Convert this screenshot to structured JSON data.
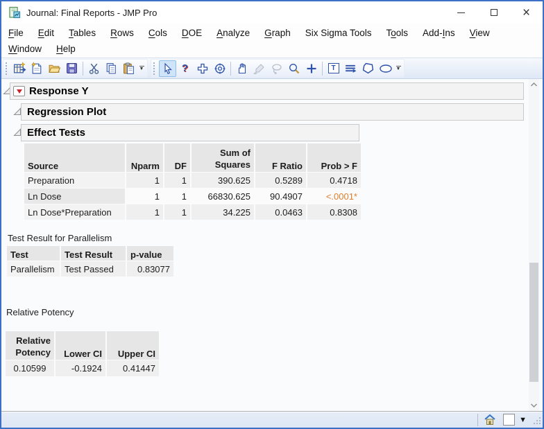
{
  "window": {
    "title": "Journal: Final Reports - JMP Pro"
  },
  "menu": {
    "row1": [
      {
        "label": "File",
        "m": 0
      },
      {
        "label": "Edit",
        "m": 0
      },
      {
        "label": "Tables",
        "m": 0
      },
      {
        "label": "Rows",
        "m": 0
      },
      {
        "label": "Cols",
        "m": 0
      },
      {
        "label": "DOE",
        "m": 0
      },
      {
        "label": "Analyze",
        "m": 0
      },
      {
        "label": "Graph",
        "m": 0
      },
      {
        "label": "Six Sigma Tools",
        "m": -1
      },
      {
        "label": "Tools",
        "m": 1
      },
      {
        "label": "Add-Ins",
        "m": 4
      },
      {
        "label": "View",
        "m": 0
      }
    ],
    "row2": [
      {
        "label": "Window",
        "m": 0
      },
      {
        "label": "Help",
        "m": 0
      }
    ]
  },
  "toolbar": {
    "groups": [
      {
        "icons": [
          "new-journal",
          "new-script",
          "open",
          "save",
          "cut",
          "copy",
          "paste"
        ]
      },
      {
        "icons": [
          "arrow-tool",
          "help-tool",
          "selection-tool",
          "bullseye-tool",
          "grabber-tool",
          "brush-tool",
          "lasso-tool",
          "magnifier-tool",
          "crosshairs-tool",
          "annotate-tool",
          "line-tool",
          "polygon-tool",
          "oval-tool"
        ]
      }
    ],
    "help_glyph": "?",
    "annotate_glyph": "T"
  },
  "outlines": [
    {
      "title": "Response Y"
    },
    {
      "title": "Regression Plot"
    },
    {
      "title": "Effect Tests"
    }
  ],
  "effect_tests": {
    "columns": {
      "source": "Source",
      "nparm": "Nparm",
      "df": "DF",
      "ss1": "Sum of",
      "ss2": "Squares",
      "f": "F Ratio",
      "p": "Prob > F"
    },
    "rows": [
      {
        "source": "Preparation",
        "nparm": "1",
        "df": "1",
        "ss": "390.625",
        "f": "0.5289",
        "p": "0.4718"
      },
      {
        "source": "Ln Dose",
        "nparm": "1",
        "df": "1",
        "ss": "66830.625",
        "f": "90.4907",
        "p": "<.0001*"
      },
      {
        "source": "Ln Dose*Preparation",
        "nparm": "1",
        "df": "1",
        "ss": "34.225",
        "f": "0.0463",
        "p": "0.8308"
      }
    ]
  },
  "parallelism": {
    "label": "Test Result for Parallelism",
    "columns": {
      "test": "Test",
      "result": "Test Result",
      "p": "p-value"
    },
    "row": {
      "test": "Parallelism",
      "result": "Test Passed",
      "p": "0.83077"
    }
  },
  "relative_potency": {
    "label": "Relative Potency",
    "columns": {
      "rp1": "Relative",
      "rp2": "Potency",
      "lower": "Lower CI",
      "upper": "Upper CI"
    },
    "row": {
      "rp": "0.10599",
      "lower": "-0.1924",
      "upper": "0.41447"
    }
  },
  "colors": {
    "significant_p": "#dd7f2e",
    "window_border": "#3c6fc5",
    "red_triangle": "#c5262c"
  }
}
